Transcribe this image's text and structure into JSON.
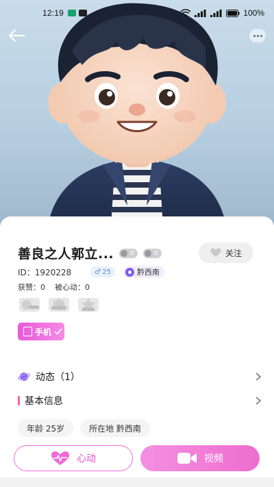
{
  "status_bar": {
    "time": "12:19",
    "battery": "100%"
  },
  "profile": {
    "name": "善良之人郭立...",
    "level_1": "0",
    "level_2": "0",
    "follow_label": "关注",
    "id_text": "ID：1920228",
    "age_badge": "25",
    "location_badge": "黔西南",
    "likes_text": "获赞：0",
    "hearted_text": "被心动：0",
    "medals": [
      "medal-1",
      "medal-2",
      "medal-3"
    ],
    "phone_badge_label": "手机"
  },
  "sections": {
    "moments_label": "动态（1）",
    "basic_info_label": "基本信息"
  },
  "info_chips": {
    "age": "年龄 25岁",
    "location": "所在地 黔西南"
  },
  "actions": {
    "like_label": "心动",
    "video_label": "视频"
  },
  "colors": {
    "accent_pink": "#ee6ecf",
    "accent_purple": "#7a5cf0",
    "badge_blue": "#5b8fd6"
  }
}
